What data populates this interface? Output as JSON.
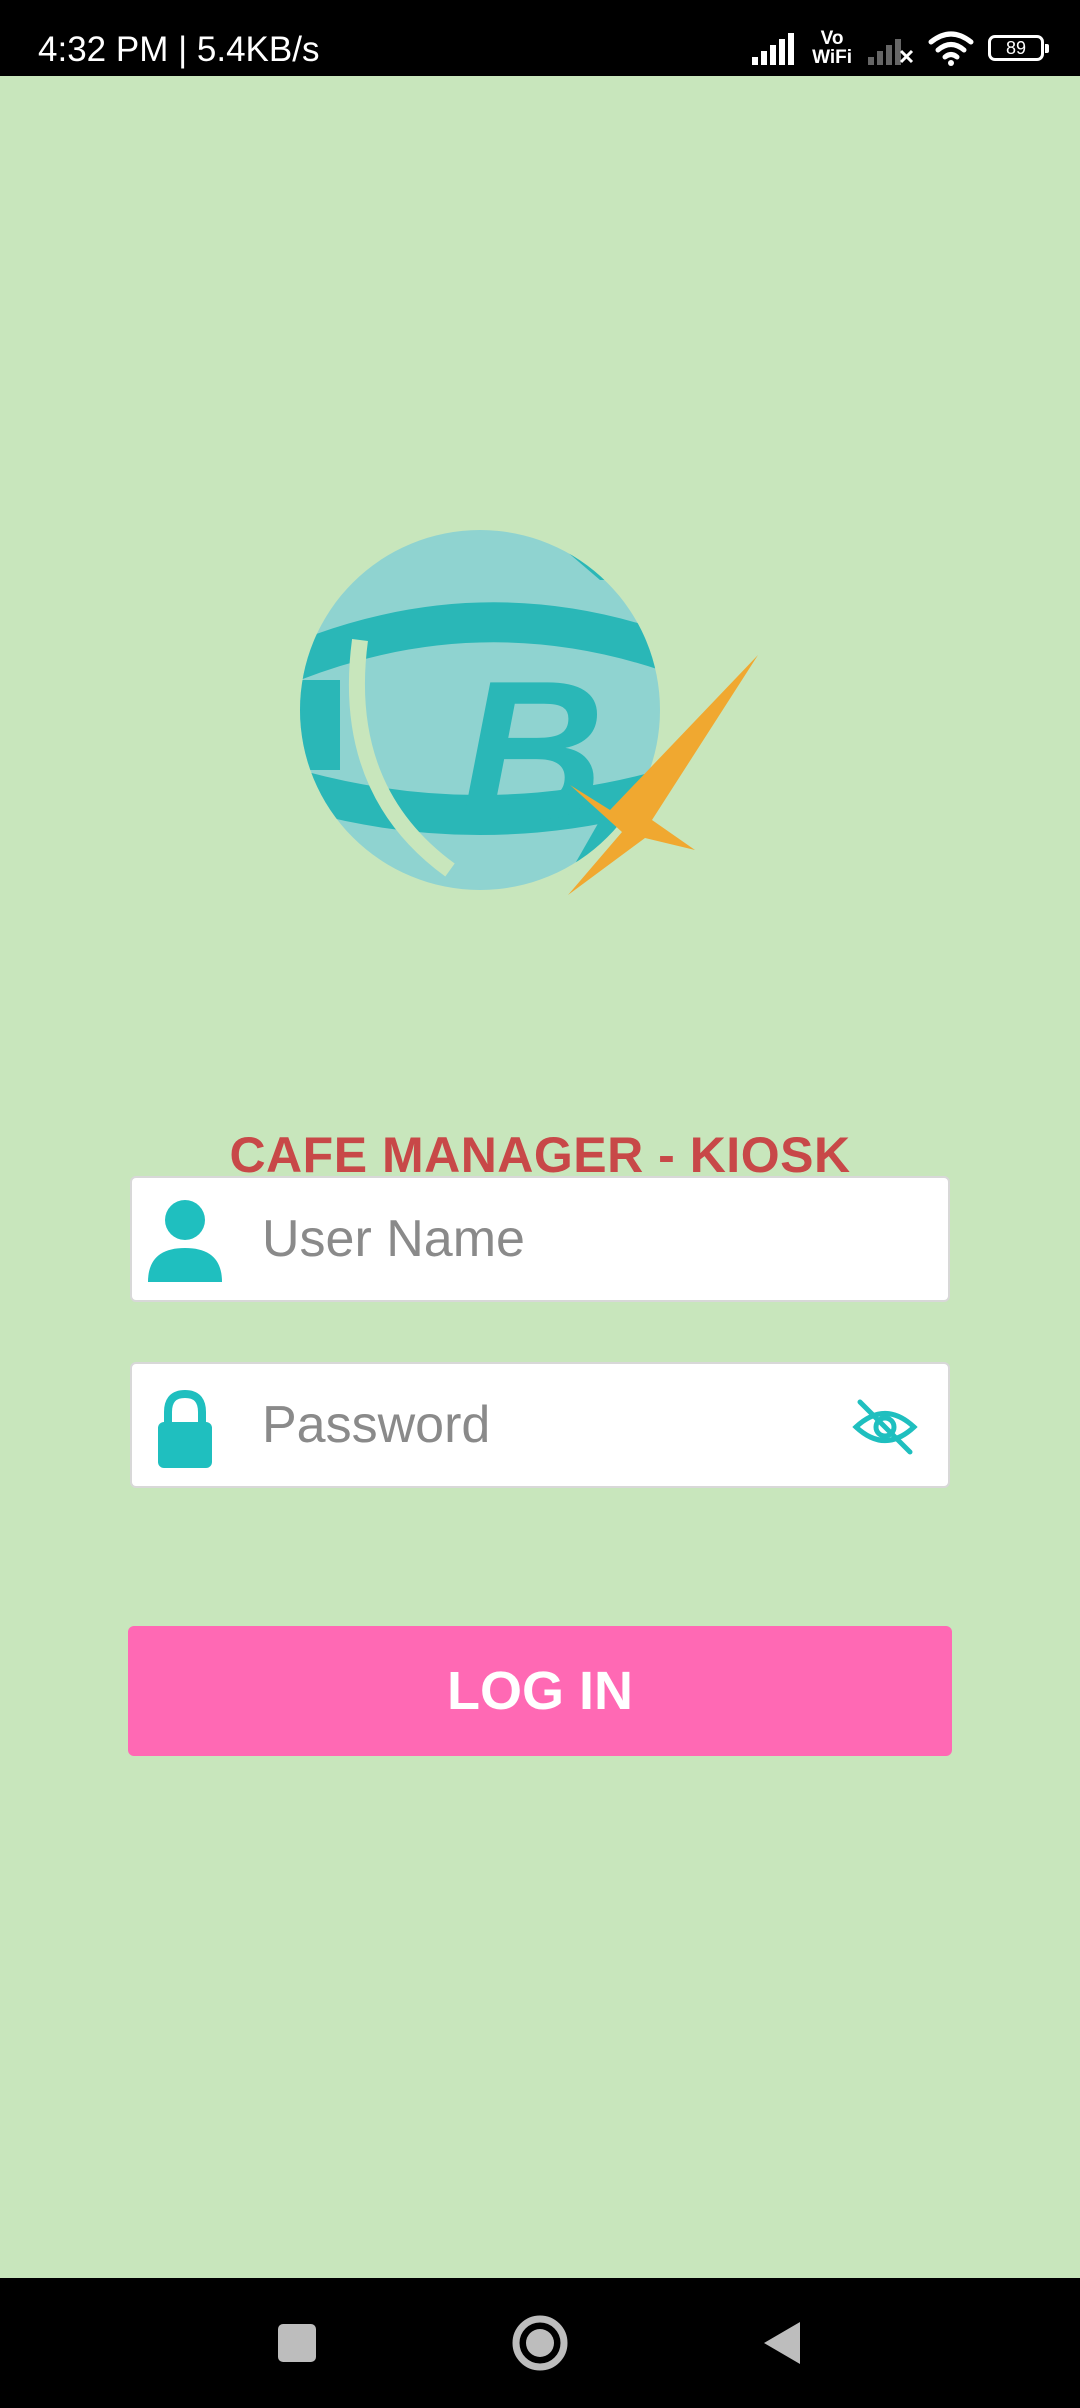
{
  "status_bar": {
    "time": "4:32 PM",
    "separator": " | ",
    "network_speed": "5.4KB/s",
    "vowifi_top": "Vo",
    "vowifi_bottom": "WiFi",
    "battery_level": "89"
  },
  "logo": {
    "letter": "B",
    "colors": {
      "globe": "#2ab7b7",
      "globe_light": "#8fd3d0",
      "star": "#f0a830"
    }
  },
  "app_title": "CAFE MANAGER - KIOSK",
  "login_form": {
    "username": {
      "placeholder": "User Name",
      "value": "",
      "icon": "user-icon"
    },
    "password": {
      "placeholder": "Password",
      "value": "",
      "icon": "lock-icon",
      "toggle_icon": "eye-off-icon"
    },
    "submit_label": "LOG IN"
  },
  "nav_bar": {
    "buttons": [
      "recent-apps",
      "home",
      "back"
    ]
  },
  "colors": {
    "background": "#c8e6bc",
    "title": "#c84848",
    "accent": "#1fbfbf",
    "login_button": "#ff69b4"
  }
}
